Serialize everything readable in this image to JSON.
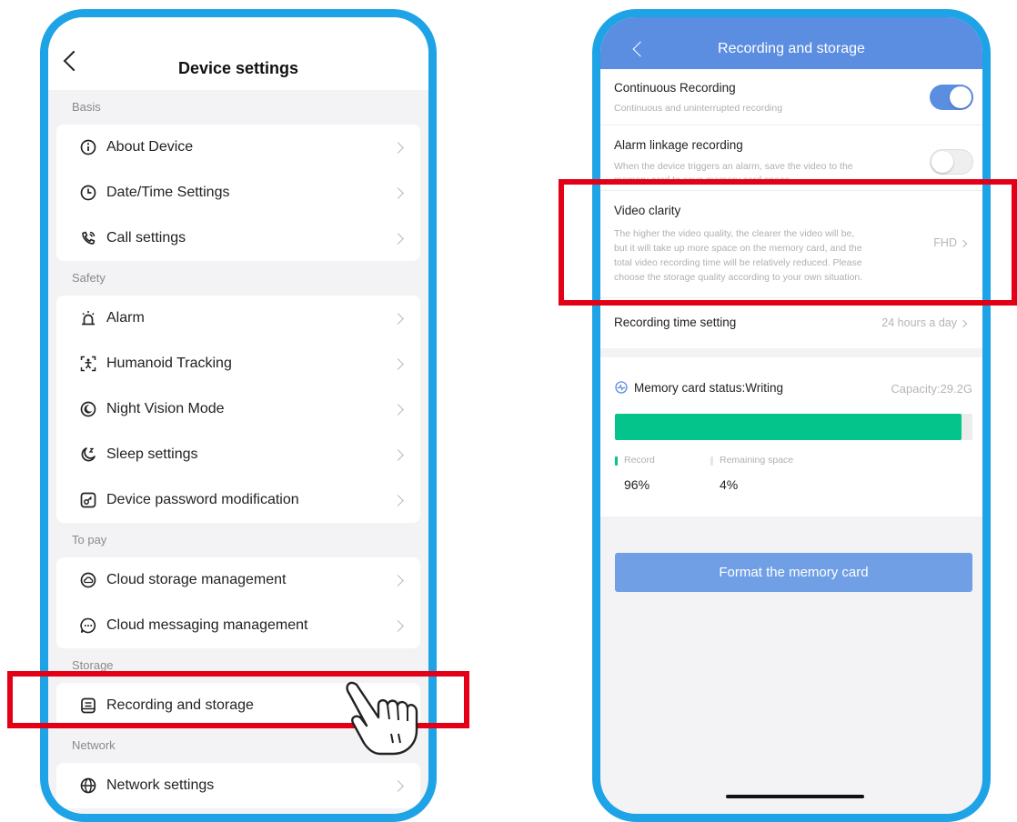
{
  "left": {
    "title": "Device settings",
    "sections": [
      {
        "label": "Basis",
        "items": [
          {
            "label": "About Device",
            "icon": "info-icon"
          },
          {
            "label": "Date/Time Settings",
            "icon": "clock-icon"
          },
          {
            "label": "Call settings",
            "icon": "phone-call-icon"
          }
        ]
      },
      {
        "label": "Safety",
        "items": [
          {
            "label": "Alarm",
            "icon": "alarm-icon"
          },
          {
            "label": "Humanoid Tracking",
            "icon": "humanoid-icon"
          },
          {
            "label": "Night Vision Mode",
            "icon": "night-vision-icon"
          },
          {
            "label": "Sleep settings",
            "icon": "sleep-icon"
          },
          {
            "label": "Device password modification",
            "icon": "password-icon"
          }
        ]
      },
      {
        "label": "To pay",
        "items": [
          {
            "label": "Cloud storage management",
            "icon": "cloud-icon"
          },
          {
            "label": "Cloud messaging management",
            "icon": "message-icon"
          }
        ]
      },
      {
        "label": "Storage",
        "items": [
          {
            "label": "Recording and storage",
            "icon": "storage-icon"
          }
        ]
      },
      {
        "label": "Network",
        "items": [
          {
            "label": "Network settings",
            "icon": "globe-icon"
          }
        ]
      }
    ]
  },
  "right": {
    "title": "Recording and storage",
    "continuous": {
      "title": "Continuous Recording",
      "desc": "Continuous and uninterrupted recording",
      "enabled": true
    },
    "alarm_linkage": {
      "title": "Alarm linkage recording",
      "desc_line1": "When the device triggers an alarm, save the video to the",
      "desc_line2": "memory card to save memory card space",
      "enabled": false
    },
    "video_clarity": {
      "title": "Video clarity",
      "desc_lines": [
        "The higher the video quality, the clearer the video will be,",
        "but it will take up more space on the memory card, and the",
        "total video recording time will be relatively reduced. Please",
        "choose the storage quality according to your own situation."
      ],
      "value": "FHD"
    },
    "recording_time": {
      "title": "Recording time setting",
      "value": "24 hours a day"
    },
    "memory": {
      "title": "Memory card status:Writing",
      "capacity": "Capacity:29.2G",
      "record_label": "Record",
      "record_value": "96%",
      "remaining_label": "Remaining space",
      "remaining_value": "4%",
      "record_fraction": 0.97
    },
    "format_button": "Format the memory card"
  },
  "colors": {
    "frame": "#1ea3e6",
    "accent": "#5b8de1",
    "record_green": "#05c48b",
    "highlight_red": "#e30016"
  }
}
